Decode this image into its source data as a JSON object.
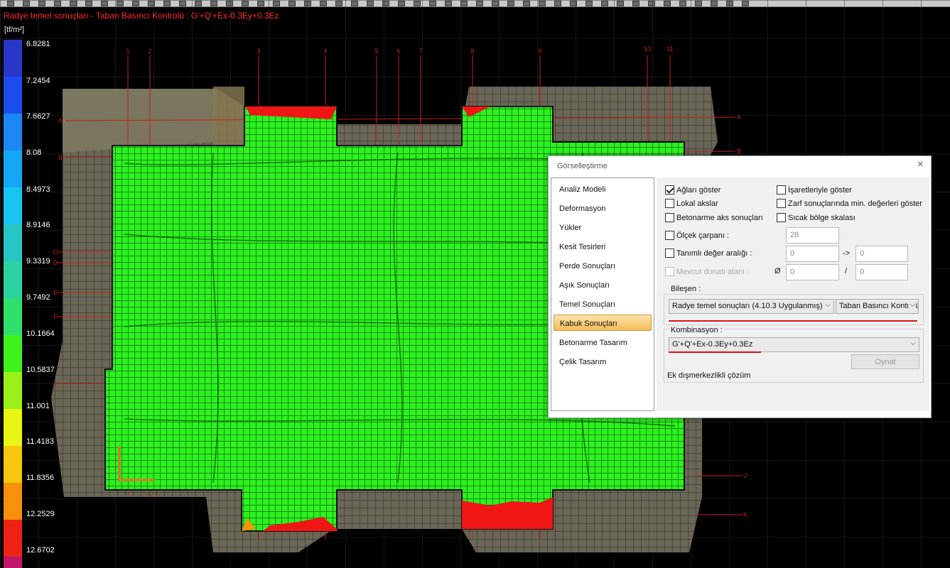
{
  "title": "Radye temel sonuçları - Taban Basıncı Kontrolü : G'+Q'+Ex-0.3Ey+0.3Ez",
  "unit": "[tf/m²]",
  "legend": [
    {
      "value": "6.8281",
      "color": "#2a36c8"
    },
    {
      "value": "7.2454",
      "color": "#1a4df0"
    },
    {
      "value": "7.6627",
      "color": "#1c86f2"
    },
    {
      "value": "8.08",
      "color": "#12a8f5"
    },
    {
      "value": "8.4973",
      "color": "#19c4f2"
    },
    {
      "value": "8.9146",
      "color": "#26c6c6"
    },
    {
      "value": "9.3319",
      "color": "#2ad4a2"
    },
    {
      "value": "9.7492",
      "color": "#2ee16a"
    },
    {
      "value": "10.1664",
      "color": "#3ef21c"
    },
    {
      "value": "10.5837",
      "color": "#9af11a"
    },
    {
      "value": "11.001",
      "color": "#e9f513"
    },
    {
      "value": "11.4183",
      "color": "#f7c70e"
    },
    {
      "value": "11.8356",
      "color": "#f7910b"
    },
    {
      "value": "12.2529",
      "color": "#ee2315"
    },
    {
      "value": "12.6702",
      "color": "#c0166c"
    }
  ],
  "axes_top": [
    "1",
    "2",
    "3",
    "4",
    "5",
    "6",
    "7",
    "8",
    "9",
    "10",
    "11"
  ],
  "axes_left": [
    "A",
    "B",
    "C",
    "D",
    "E",
    "F",
    "I"
  ],
  "axes_right": [
    "A",
    "B",
    "J",
    "K"
  ],
  "dialog": {
    "title": "Görselleştirme",
    "close": "×",
    "nav": [
      "Analiz Modeli",
      "Deformasyon",
      "Yükler",
      "Kesit Tesirleri",
      "Perde Sonuçları",
      "Aşık Sonuçları",
      "Temel Sonuçları",
      "Kabuk Sonuçları",
      "Betonarme Tasarım",
      "Çelik Tasarım"
    ],
    "active_nav": "Kabuk Sonuçları",
    "options": {
      "aglari_goster": "Ağları göster",
      "lokal_akslar": "Lokal akslar",
      "betonarme_aks": "Betonarme aks sonuçları",
      "isaretleriyle": "İşaretleriyle göster",
      "zarf_min": "Zarf sonuçlarında min. değerleri göster",
      "sicak_bolge": "Sıcak bölge skalası",
      "olcek": "Ölçek çarpanı :",
      "olcek_value": "28",
      "tanimli": "Tanımlı değer aralığı :",
      "tanimli_from": "0",
      "arrow": "->",
      "tanimli_to": "0",
      "mevcut": "Mevcut donatı alanı :",
      "diameter": "Ø",
      "mevcut_d": "0",
      "slash": "/",
      "mevcut_s": "0"
    },
    "bilesen_label": "Bileşen :",
    "bilesen_select_1": "Radye temel sonuçları (4.10.3 Uygulanmış)",
    "bilesen_select_2": "Taban Basıncı Kontrolü",
    "kombinasyon_label": "Kombinasyon :",
    "kombinasyon_select": "G'+Q'+Ex-0.3Ey+0.3Ez",
    "play_button": "Oynat",
    "ek_label": "Ek dışmerkezlikli çözüm"
  }
}
